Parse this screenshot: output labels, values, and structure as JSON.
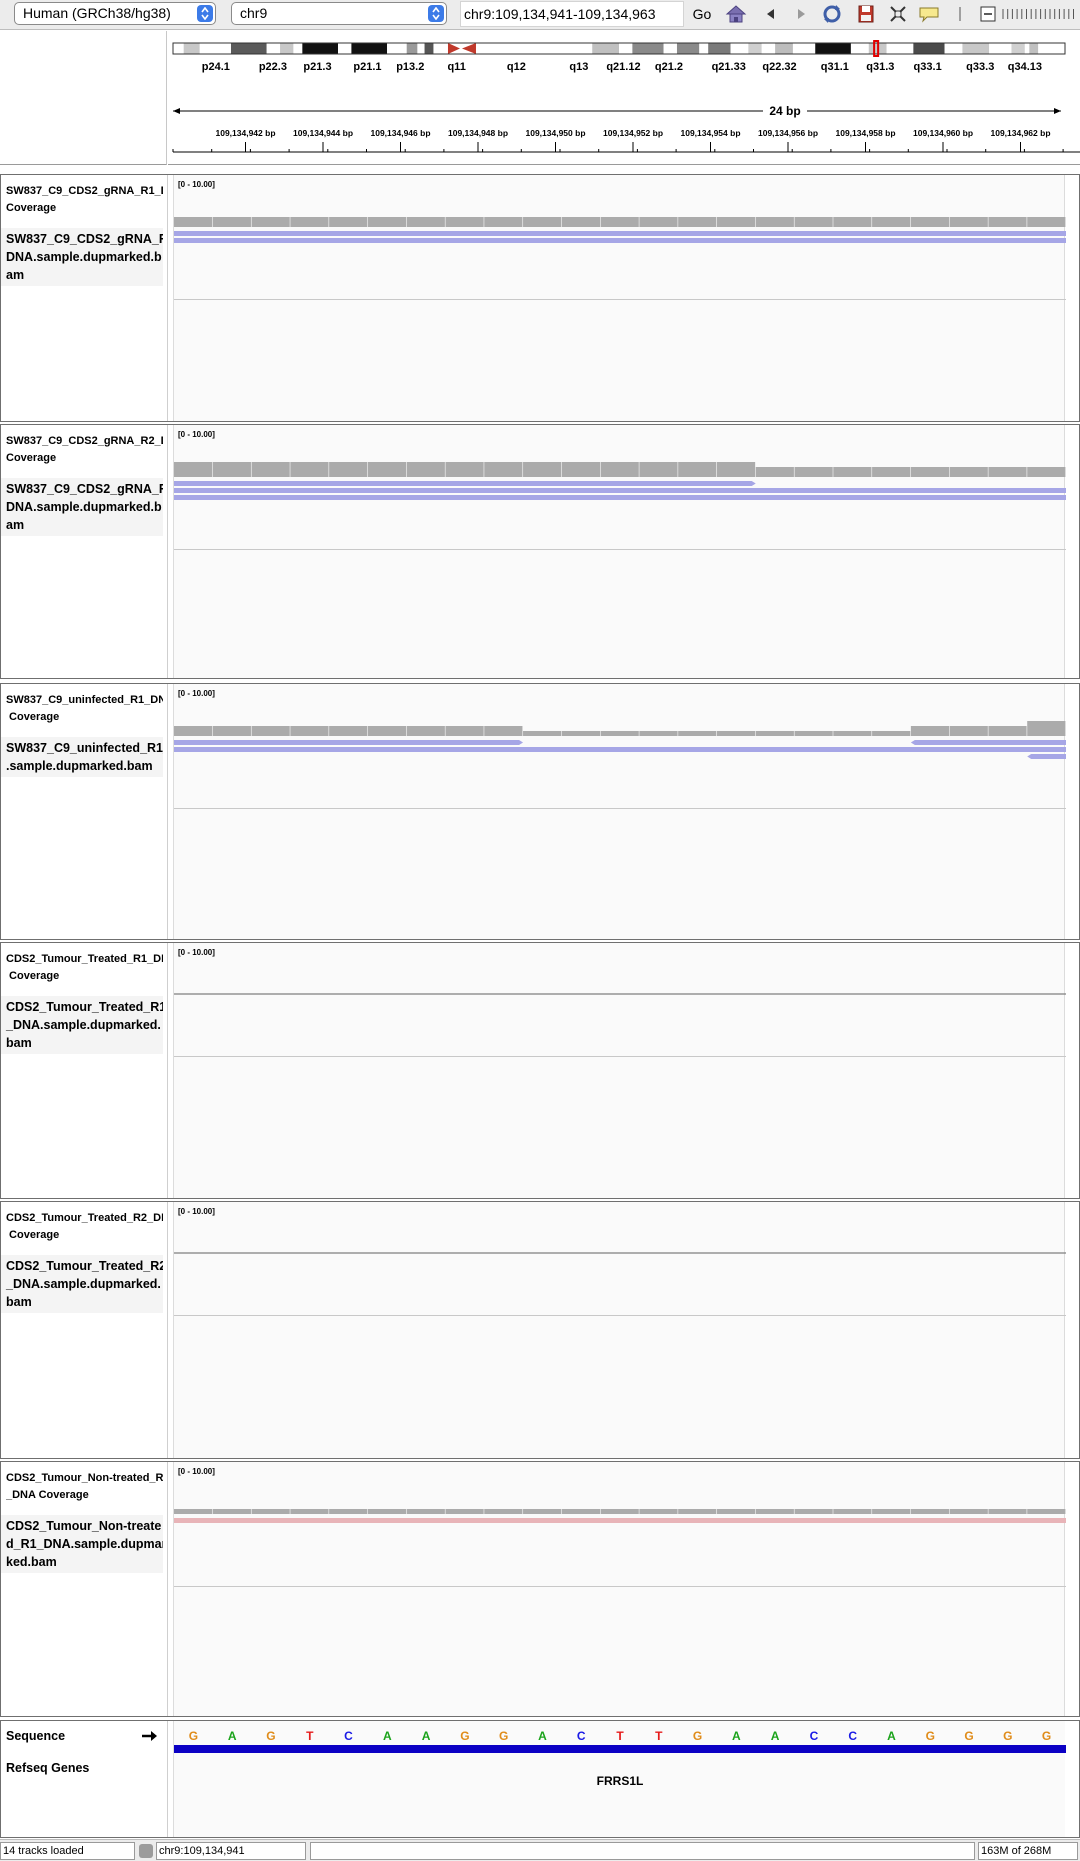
{
  "toolbar": {
    "genome": "Human (GRCh38/hg38)",
    "chromosome": "chr9",
    "locus": "chr9:109,134,941-109,134,963",
    "go_label": "Go",
    "icons": [
      "home-icon",
      "back-icon",
      "forward-icon",
      "refresh-icon",
      "save-session-icon",
      "select-region-icon",
      "popup-text-icon",
      "zoom-out-icon",
      "zoom-slider-icon"
    ]
  },
  "ideogram": {
    "bands": [
      "p24.1",
      "p22.3",
      "p21.3",
      "p21.1",
      "p13.2",
      "q11",
      "q12",
      "q13",
      "q21.12",
      "q21.2",
      "q21.33",
      "q22.32",
      "q31.1",
      "q31.3",
      "q33.1",
      "q33.3",
      "q34.13"
    ],
    "current_band": "q31.3"
  },
  "ruler": {
    "span_label": "24 bp",
    "ticks": [
      "109,134,942 bp",
      "109,134,944 bp",
      "109,134,946 bp",
      "109,134,948 bp",
      "109,134,950 bp",
      "109,134,952 bp",
      "109,134,954 bp",
      "109,134,956 bp",
      "109,134,958 bp",
      "109,134,960 bp",
      "109,134,962 bp",
      "109,"
    ]
  },
  "tracks": [
    {
      "coverage_name": "SW837_C9_CDS2_gRNA_R1_D\nCoverage",
      "alignment_name": "SW837_C9_CDS2_gRNA_R\nDNA.sample.dupmarked.b\nam",
      "range": "[0 - 10.00]",
      "coverage_levels": [
        2,
        2,
        2,
        2,
        2,
        2,
        2,
        2,
        2,
        2,
        2,
        2,
        2,
        2,
        2,
        2,
        2,
        2,
        2,
        2,
        2,
        2,
        2
      ],
      "reads": [
        {
          "start": 0,
          "end": 23,
          "color": "#a6a6e6",
          "strand": "+"
        },
        {
          "start": 0,
          "end": 23,
          "color": "#a6a6e6",
          "strand": "+"
        }
      ]
    },
    {
      "coverage_name": "SW837_C9_CDS2_gRNA_R2_D\nCoverage",
      "alignment_name": "SW837_C9_CDS2_gRNA_R\nDNA.sample.dupmarked.b\nam",
      "range": "[0 - 10.00]",
      "coverage_levels": [
        3,
        3,
        3,
        3,
        3,
        3,
        3,
        3,
        3,
        3,
        3,
        3,
        3,
        3,
        3,
        2,
        2,
        2,
        2,
        2,
        2,
        2,
        2
      ],
      "reads": [
        {
          "start": 0,
          "end": 15,
          "color": "#a6a6e6",
          "strand": "+"
        },
        {
          "start": 0,
          "end": 23,
          "color": "#a6a6e6",
          "strand": "+"
        },
        {
          "start": 0,
          "end": 23,
          "color": "#a6a6e6",
          "strand": "+"
        }
      ]
    },
    {
      "coverage_name": "SW837_C9_uninfected_R1_DN\n Coverage",
      "alignment_name": "SW837_C9_uninfected_R1_\n.sample.dupmarked.bam",
      "range": "[0 - 10.00]",
      "coverage_levels": [
        2,
        2,
        2,
        2,
        2,
        2,
        2,
        2,
        2,
        1,
        1,
        1,
        1,
        1,
        1,
        1,
        1,
        1,
        1,
        2,
        2,
        2,
        3
      ],
      "reads": [
        {
          "start": 0,
          "end": 9,
          "color": "#a6a6e6",
          "strand": "+"
        },
        {
          "start": 19,
          "end": 23,
          "color": "#a6a6e6",
          "strand": "-"
        },
        {
          "start": 0,
          "end": 23,
          "color": "#a6a6e6",
          "strand": "+"
        },
        {
          "start": 22,
          "end": 23,
          "color": "#a6a6e6",
          "strand": "-"
        }
      ]
    },
    {
      "coverage_name": "CDS2_Tumour_Treated_R1_DN\n Coverage",
      "alignment_name": "CDS2_Tumour_Treated_R1\n_DNA.sample.dupmarked.\nbam",
      "range": "[0 - 10.00]",
      "coverage_levels": [],
      "reads": []
    },
    {
      "coverage_name": "CDS2_Tumour_Treated_R2_DN\n Coverage",
      "alignment_name": "CDS2_Tumour_Treated_R2\n_DNA.sample.dupmarked.\nbam",
      "range": "[0 - 10.00]",
      "coverage_levels": [],
      "reads": []
    },
    {
      "coverage_name": "CDS2_Tumour_Non-treated_R\n_DNA Coverage",
      "alignment_name": "CDS2_Tumour_Non-treate\nd_R1_DNA.sample.dupmar\nked.bam",
      "range": "[0 - 10.00]",
      "coverage_levels": [
        1,
        1,
        1,
        1,
        1,
        1,
        1,
        1,
        1,
        1,
        1,
        1,
        1,
        1,
        1,
        1,
        1,
        1,
        1,
        1,
        1,
        1,
        1
      ],
      "reads": [
        {
          "start": 0,
          "end": 23,
          "color": "#e8b4b8",
          "strand": "+"
        }
      ]
    }
  ],
  "sequence": {
    "label": "Sequence",
    "bases": [
      "G",
      "A",
      "G",
      "T",
      "C",
      "A",
      "A",
      "G",
      "G",
      "A",
      "C",
      "T",
      "T",
      "G",
      "A",
      "A",
      "C",
      "C",
      "A",
      "G",
      "G",
      "G",
      "G"
    ],
    "colors": {
      "A": "#1aa31a",
      "C": "#1a1ae6",
      "G": "#e08c1a",
      "T": "#e61a1a"
    }
  },
  "genes": {
    "label": "Refseq Genes",
    "gene_name": "FRRS1L"
  },
  "status": {
    "tracks_loaded": "14 tracks loaded",
    "position": "chr9:109,134,941",
    "message": "",
    "memory": "163M of 268M"
  }
}
